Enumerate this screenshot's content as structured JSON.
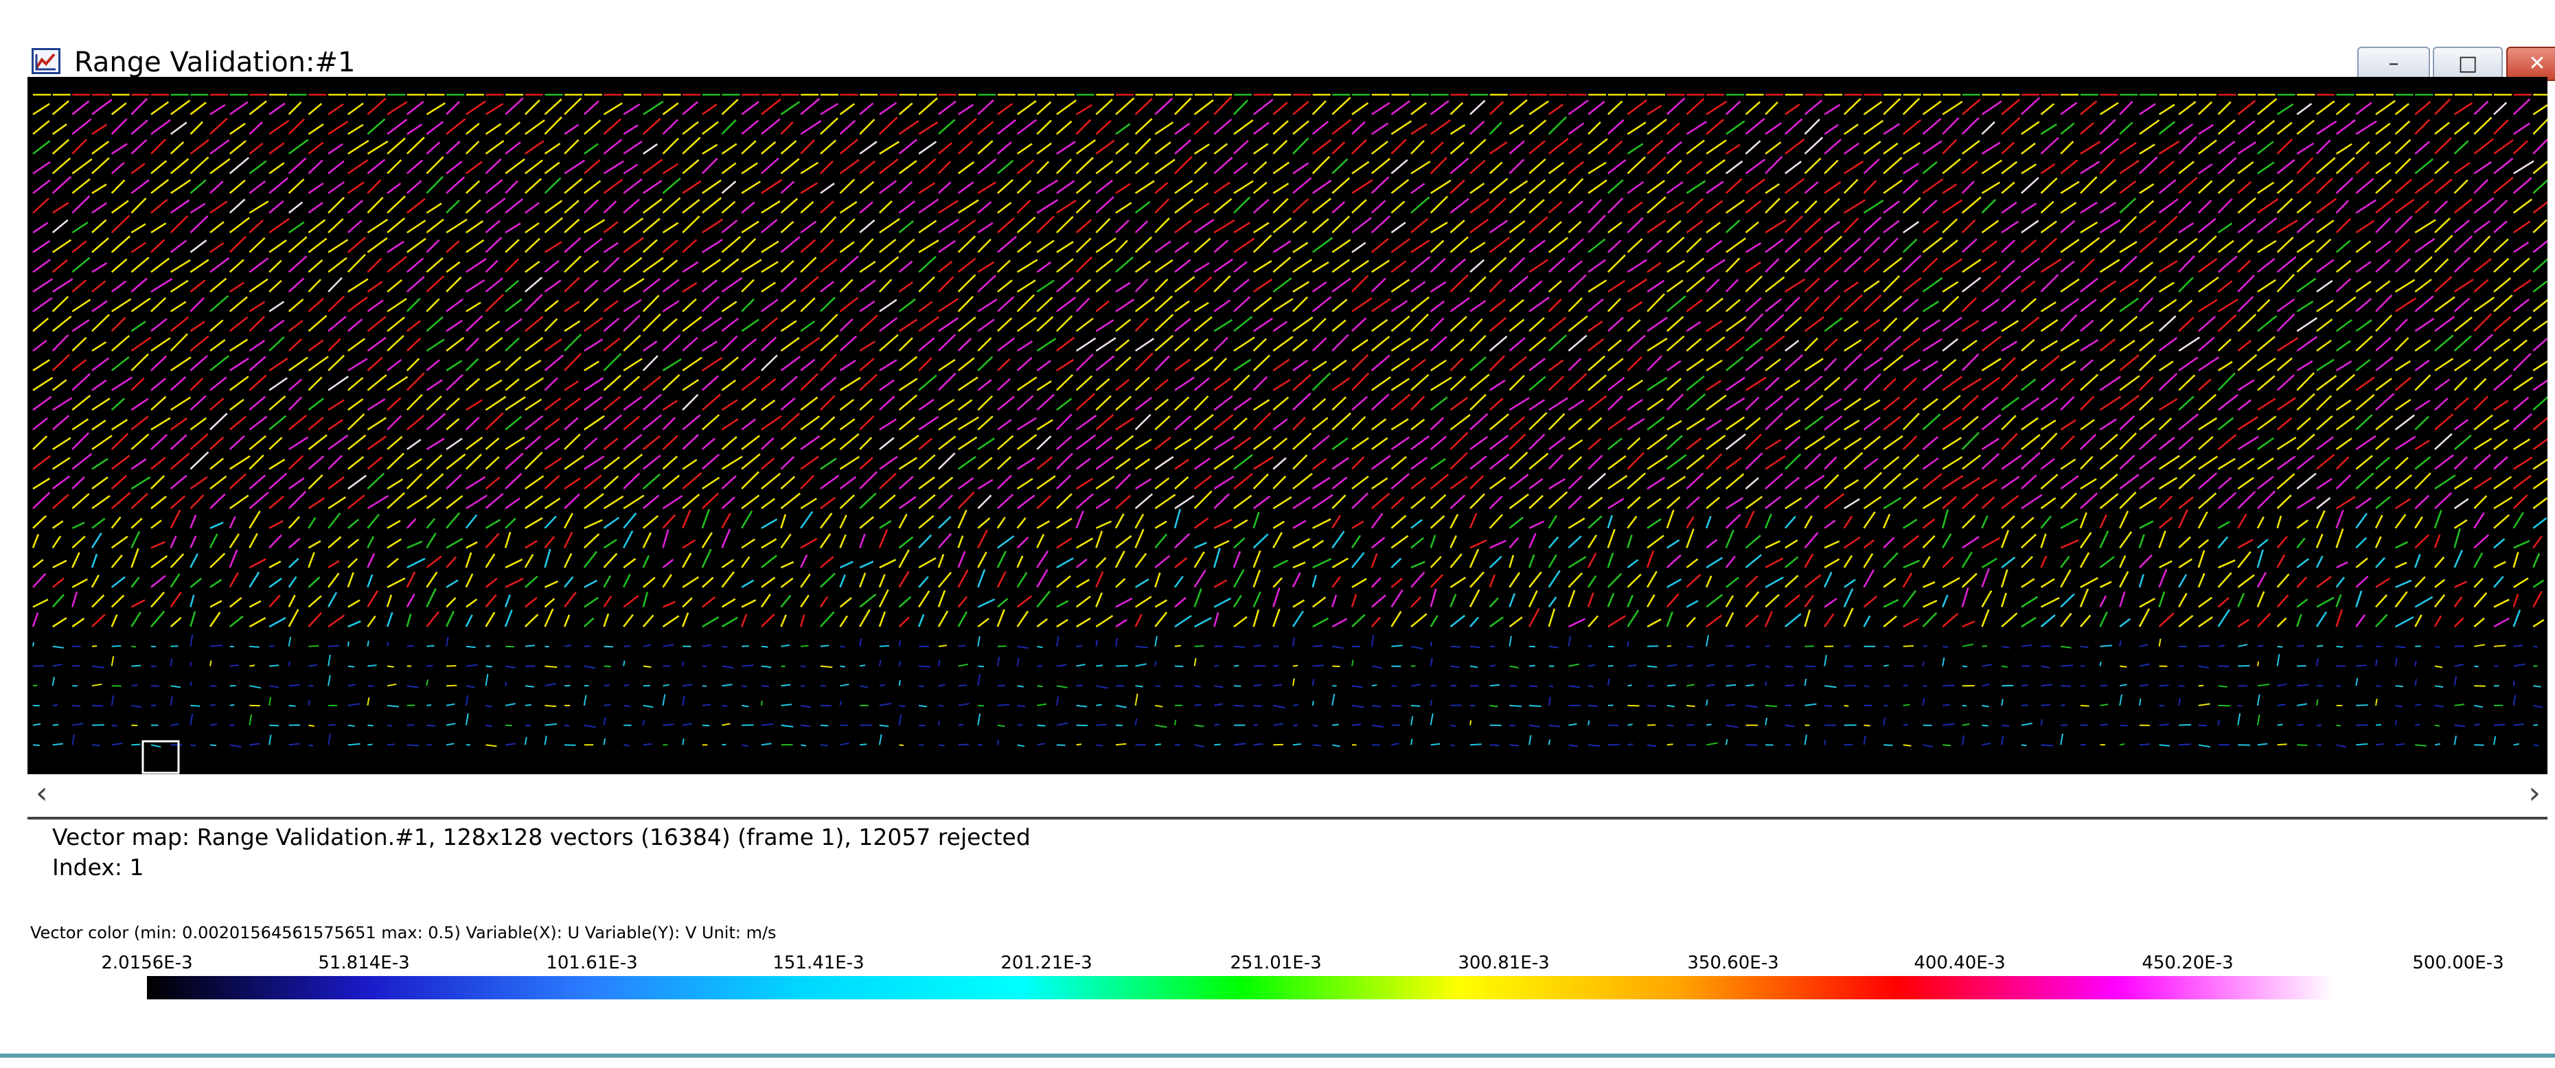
{
  "window": {
    "title": "Range Validation:#1",
    "icon": "chart-icon",
    "controls": {
      "minimize": "–",
      "maximize": "□",
      "close": "✕"
    }
  },
  "plot": {
    "icon_left": "chevron-left-icon",
    "icon_right": "chevron-right-icon",
    "scroll_left": "‹",
    "scroll_right": "›"
  },
  "status": {
    "line1": "Vector map: Range Validation.#1, 128x128 vectors (16384) (frame 1), 12057 rejected",
    "line2": "Index: 1"
  },
  "legend": {
    "caption": "Vector color (min: 0.00201564561575651 max: 0.5) Variable(X): U Variable(Y): V Unit: m/s",
    "ticks": [
      "2.0156E-3",
      "51.814E-3",
      "101.61E-3",
      "151.41E-3",
      "201.21E-3",
      "251.01E-3",
      "300.81E-3",
      "350.60E-3",
      "400.40E-3",
      "450.20E-3",
      "500.00E-3"
    ],
    "stops": [
      "#000000",
      "#1a1ac8",
      "#2a7cff",
      "#00d8ff",
      "#00ffff",
      "#00ff00",
      "#ffff00",
      "#ffa500",
      "#ff0000",
      "#ff00ff",
      "#ffffff"
    ]
  },
  "colors": {
    "background": "#000000",
    "window_border": "#5a9fb0"
  }
}
